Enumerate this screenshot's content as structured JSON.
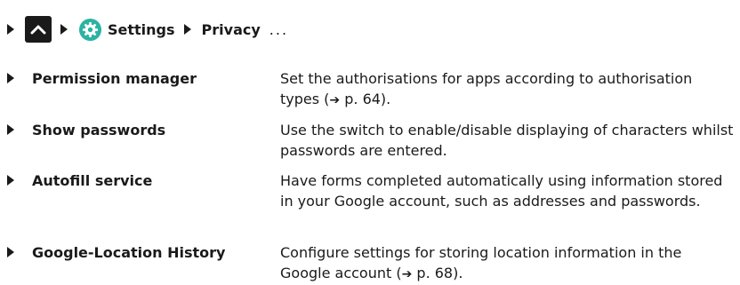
{
  "breadcrumb": {
    "settings_label": "Settings",
    "privacy_label": "Privacy",
    "ellipsis": "..."
  },
  "rows": [
    {
      "term": "Permission manager",
      "desc_before": "Set the authorisations for apps according to authorisation types (",
      "page_ref": "p. 64",
      "desc_after": ")."
    },
    {
      "term": "Show passwords",
      "desc": "Use the switch to enable/disable displaying of characters whilst passwords are entered."
    },
    {
      "term": "Autofill service",
      "desc": "Have forms completed automatically using information stored in your Google account, such as addresses and passwords."
    },
    {
      "term": "Google-Location History",
      "desc_before": "Configure settings for storing location information in the Google account (",
      "page_ref": "p. 68",
      "desc_after": ")."
    }
  ],
  "colors": {
    "text": "#1a1a1a",
    "settings_icon": "#2bb3a3"
  }
}
